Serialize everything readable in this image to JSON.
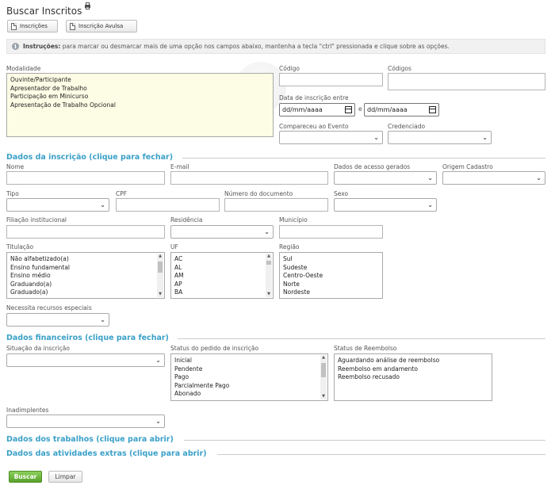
{
  "page": {
    "title": "Buscar Inscritos"
  },
  "toolbar": {
    "inscricoes": "Inscrições",
    "avulsa": "Inscrição Avulsa"
  },
  "info": {
    "bold": "Instruções:",
    "text": "para marcar ou desmarcar mais de uma opção nos campos abaixo, mantenha a tecla \"ctrl\" pressionada e clique sobre as opções.",
    "ctrl": "ctrl"
  },
  "filters": {
    "modalidade": {
      "label": "Modalidade",
      "options": [
        "Ouvinte/Participante",
        "Apresentador de Trabalho",
        "Participação em Minicurso",
        "Apresentação de Trabalho Opcional"
      ]
    },
    "codigo": {
      "label": "Código"
    },
    "codigos": {
      "label": "Códigos"
    },
    "data_inscricao": {
      "label": "Data de inscrição entre",
      "from_placeholder": "dd/mm/aaaa",
      "to_placeholder": "dd/mm/aaaa",
      "sep": "e"
    },
    "compareceu": {
      "label": "Compareceu ao Evento"
    },
    "credenciado": {
      "label": "Credenciado"
    }
  },
  "sections": {
    "inscricao": "Dados da inscrição (clique para fechar)",
    "financeiros": "Dados financeiros (clique para fechar)",
    "trabalhos": "Dados dos trabalhos (clique para abrir)",
    "atividades": "Dados das atividades extras (clique para abrir)"
  },
  "inscricao": {
    "nome": "Nome",
    "email": "E-mail",
    "acesso": "Dados de acesso gerados",
    "origem": "Origem Cadastro",
    "tipo": "Tipo",
    "cpf": "CPF",
    "documento": "Número do documento",
    "sexo": "Sexo",
    "filiacao": "Filiação institucional",
    "residencia": "Residência",
    "municipio": "Município",
    "titulacao": {
      "label": "Titulação",
      "options": [
        "Não alfabetizado(a)",
        "Ensino fundamental",
        "Ensino médio",
        "Graduando(a)",
        "Graduado(a)"
      ]
    },
    "uf": {
      "label": "UF",
      "options": [
        "AC",
        "AL",
        "AM",
        "AP",
        "BA"
      ]
    },
    "regiao": {
      "label": "Região",
      "options": [
        "Sul",
        "Sudeste",
        "Centro-Oeste",
        "Norte",
        "Nordeste"
      ]
    },
    "recursos": "Necessita recursos especiais"
  },
  "financeiros": {
    "situacao": "Situação da inscrição",
    "status_pedido": {
      "label": "Status do pedido de inscrição",
      "options": [
        "Inicial",
        "Pendente",
        "Pago",
        "Parcialmente Pago",
        "Abonado"
      ]
    },
    "reembolso": {
      "label": "Status de Reembolso",
      "options": [
        "Aguardando análise de reembolso",
        "Reembolso em andamento",
        "Reembolso recusado"
      ]
    },
    "inadimplentes": "Inadimplentes"
  },
  "actions": {
    "buscar": "Buscar",
    "limpar": "Limpar"
  },
  "colors": {
    "section": "#3aa0c8",
    "buscar": "#6bb43c",
    "modalidade_bg": "#fdfde6"
  },
  "icons": {
    "title": "printer-icon",
    "toolbar": "document-icon",
    "info": "info-icon",
    "date": "calendar-icon"
  }
}
